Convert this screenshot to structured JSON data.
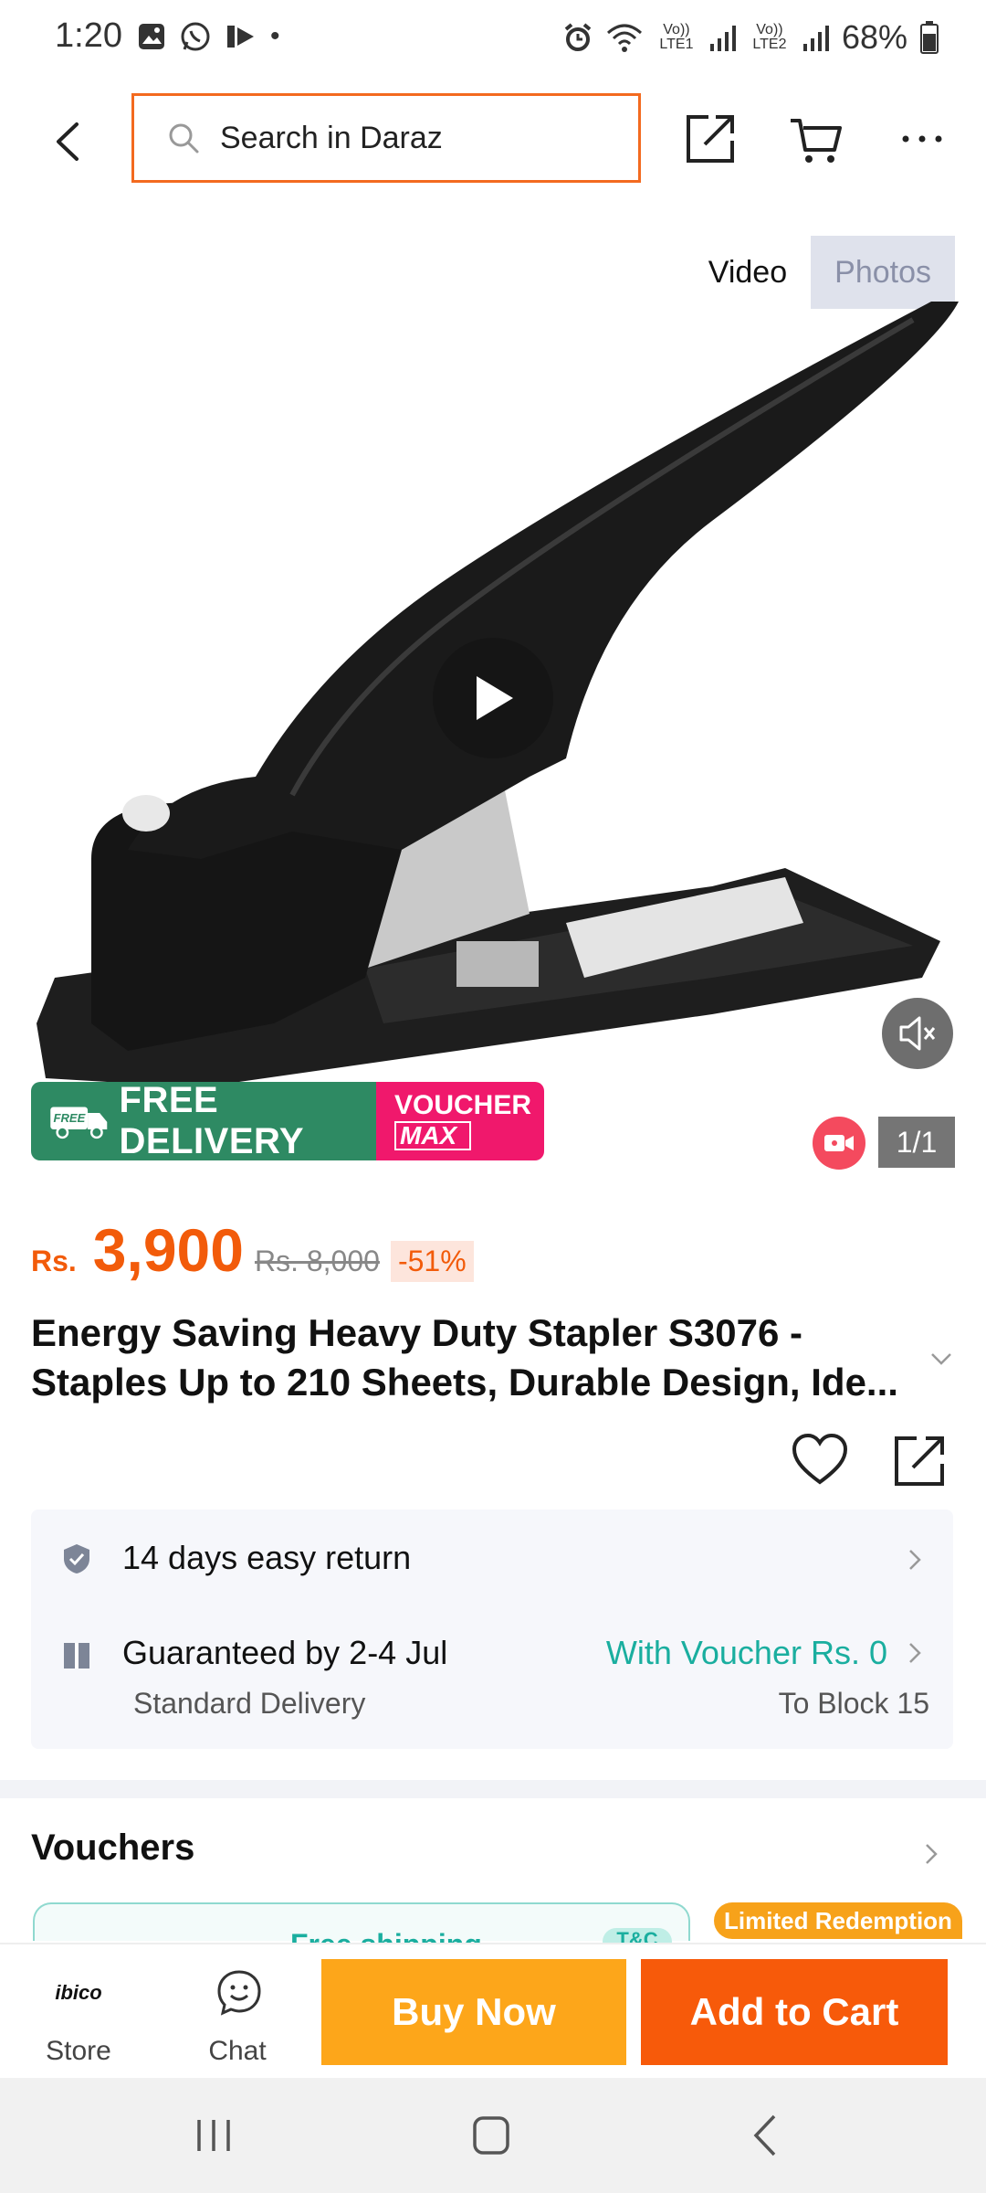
{
  "status_bar": {
    "time": "1:20",
    "lte1": "Vo)) LTE1",
    "lte2": "Vo)) LTE2",
    "battery": "68%",
    "dot": "•"
  },
  "header": {
    "search_placeholder": "Search in Daraz",
    "icons": [
      "back-arrow-icon",
      "share-icon",
      "cart-icon",
      "more-icon"
    ]
  },
  "media": {
    "tabs": {
      "video": "Video",
      "photos": "Photos"
    },
    "counter": "1/1",
    "promo_free_delivery": "FREE DELIVERY",
    "promo_free_tag": "FREE",
    "promo_voucher_line1": "VOUCHER",
    "promo_voucher_line2": "MAX"
  },
  "product": {
    "currency": "Rs.",
    "price": "3,900",
    "original_price": "Rs. 8,000",
    "discount": "-51%",
    "title_line1": "Energy Saving Heavy Duty Stapler S3076 -",
    "title_line2": "Staples Up to 210 Sheets, Durable Design, Ide..."
  },
  "service": {
    "return_text": "14 days easy return",
    "delivery_text": "Guaranteed by 2-4 Jul",
    "delivery_type": "Standard Delivery",
    "voucher_text": "With Voucher Rs. 0",
    "location": "To Block 15"
  },
  "vouchers": {
    "title": "Vouchers",
    "card_label": "Free shipping",
    "tc": "T&C",
    "limited": "Limited Redemption"
  },
  "bottom_bar": {
    "store_logo": "ibico",
    "store_label": "Store",
    "chat_label": "Chat",
    "buy_now": "Buy Now",
    "add_to_cart": "Add to Cart"
  },
  "colors": {
    "accent_orange": "#f25b0a",
    "buy_now": "#fda61a",
    "add_to_cart": "#f75a0a",
    "teal": "#1aae9f",
    "free_delivery_green": "#2e8a63",
    "voucher_pink": "#f0186c"
  }
}
